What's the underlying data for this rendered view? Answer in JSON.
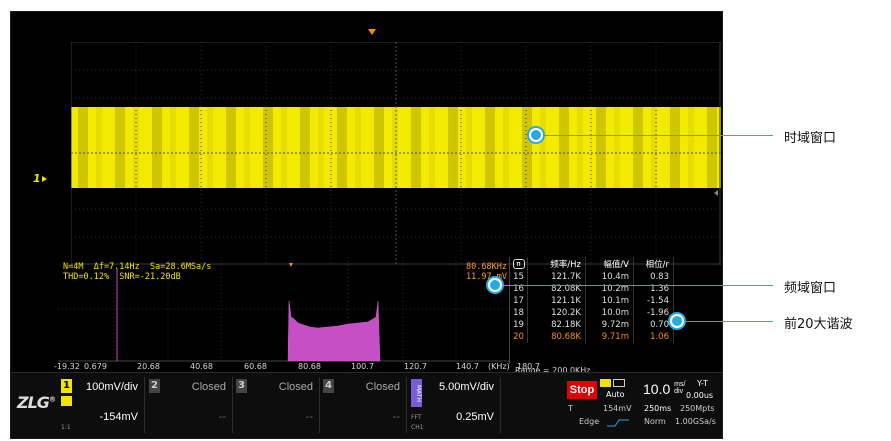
{
  "fft": {
    "line1": "N=4M  Δf=7.14Hz  Sa=28.6MSa/s",
    "line2": "THD=0.12%  SNR=-21.20dB",
    "marker_freq": "80.68KHz",
    "marker_amp": "11.97 mV",
    "x_ticks": [
      "-19.32",
      "0.679",
      "20.68",
      "40.68",
      "60.68",
      "80.68",
      "100.7",
      "120.7",
      "140.7",
      "(KHz)",
      "180.7"
    ],
    "range": "Range = 200.0KHz"
  },
  "markers": {
    "ch1": "1",
    "trigger": "T"
  },
  "harmonics": {
    "headers": [
      "频率/Hz",
      "幅值/V",
      "相位/r"
    ],
    "rows": [
      {
        "n": "15",
        "freq": "121.7K",
        "amp": "10.4m",
        "phase": "0.83"
      },
      {
        "n": "16",
        "freq": "82.08K",
        "amp": "10.2m",
        "phase": "1.36"
      },
      {
        "n": "17",
        "freq": "121.1K",
        "amp": "10.1m",
        "phase": "-1.54"
      },
      {
        "n": "18",
        "freq": "120.2K",
        "amp": "10.0m",
        "phase": "-1.96"
      },
      {
        "n": "19",
        "freq": "82.18K",
        "amp": "9.72m",
        "phase": "0.70"
      },
      {
        "n": "20",
        "freq": "80.68K",
        "amp": "9.71m",
        "phase": "1.06"
      }
    ]
  },
  "status": {
    "logo": "ZLG",
    "logo_reg": "®",
    "ch1": {
      "num": "1",
      "scale": "100mV/div",
      "offset": "-154mV",
      "sub": "1:1"
    },
    "ch2": {
      "num": "2",
      "scale": "Closed",
      "offset": "--"
    },
    "ch3": {
      "num": "3",
      "scale": "Closed",
      "offset": "--"
    },
    "ch4": {
      "num": "4",
      "scale": "Closed",
      "offset": "--"
    },
    "math": {
      "label": "MATH",
      "scale": "5.00mV/div",
      "offset": "0.25mV",
      "sub1": "FFT",
      "sub2": "CH1"
    },
    "stop": "Stop",
    "trig_mode": "Auto",
    "trig_src": "T",
    "trig_level": "154mV",
    "trig_type": "Edge",
    "timebase": "10.0",
    "timebase_unit_top": "ms/",
    "timebase_unit_bot": "div",
    "mode": "Y-T",
    "delay": "0.00us",
    "mem1": "250ms",
    "mem2": "250Mpts",
    "acq": "Norm",
    "sa": "1.00GSa/s"
  },
  "annotations": {
    "time_window": "时域窗口",
    "freq_window": "频域窗口",
    "harmonics": "前20大谐波"
  },
  "colors": {
    "ch1": "#f2e400",
    "fft": "#c64fc6",
    "accent": "#29a9e1",
    "stop": "#e00000"
  }
}
